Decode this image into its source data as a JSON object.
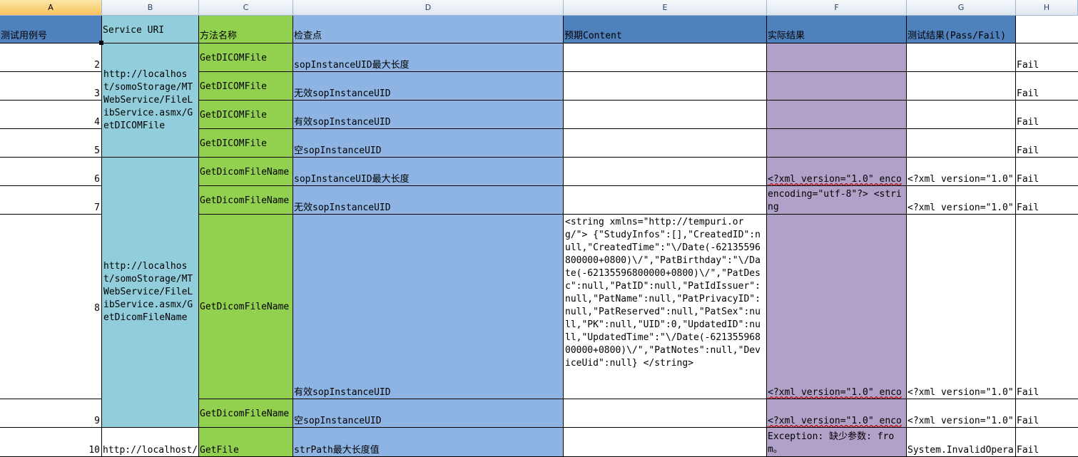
{
  "column_headers": [
    "A",
    "B",
    "C",
    "D",
    "E",
    "F",
    "G",
    "H"
  ],
  "active_column": "A",
  "table_headers": {
    "a": "测试用例号",
    "b": "Service URI",
    "c": "方法名称",
    "d": "检查点",
    "e": "预期Content",
    "f": "实际结果",
    "g": "测试结果(Pass/Fail)"
  },
  "rows": [
    {
      "num": "2",
      "method": "GetDICOMFile",
      "check": "sopInstanceUID最大长度",
      "expected": "",
      "actual": "",
      "result": "",
      "h": "Fail"
    },
    {
      "num": "3",
      "method": "GetDICOMFile",
      "check": "无效sopInstanceUID",
      "expected": "",
      "actual": "",
      "result": "",
      "h": "Fail"
    },
    {
      "num": "4",
      "method": "GetDICOMFile",
      "check": "有效sopInstanceUID",
      "expected": "",
      "actual": "",
      "result": "",
      "h": "Fail"
    },
    {
      "num": "5",
      "method": "GetDICOMFile",
      "check": "空sopInstanceUID",
      "expected": "",
      "actual": "",
      "result": "",
      "h": "Fail"
    },
    {
      "num": "6",
      "method": "GetDicomFileName",
      "check": "sopInstanceUID最大长度",
      "expected": "",
      "actual": "<?xml version=\"1.0\" enco",
      "result": "<?xml version=\"1.0\"",
      "h": "Fail"
    },
    {
      "num": "7",
      "method": "GetDicomFileName",
      "check": "无效sopInstanceUID",
      "expected": "",
      "actual": "encoding=\"utf-8\"?> <string",
      "result": "<?xml version=\"1.0\"",
      "h": "Fail"
    },
    {
      "num": "8",
      "method": "GetDicomFileName",
      "check": "有效sopInstanceUID",
      "expected": "<string xmlns=\"http://tempuri.org/\"> {\"StudyInfos\":[],\"CreatedID\":null,\"CreatedTime\":\"\\/Date(-62135596800000+0800)\\/\",\"PatBirthday\":\"\\/Date(-62135596800000+0800)\\/\",\"PatDesc\":null,\"PatID\":null,\"PatIdIssuer\":null,\"PatName\":null,\"PatPrivacyID\":null,\"PatReserved\":null,\"PatSex\":null,\"PK\":null,\"UID\":0,\"UpdatedID\":null,\"UpdatedTime\":\"\\/Date(-62135596800000+0800)\\/\",\"PatNotes\":null,\"DeviceUid\":null} </string>",
      "actual": "<?xml version=\"1.0\" enco",
      "result": "<?xml version=\"1.0\"",
      "h": "Fail"
    },
    {
      "num": "9",
      "method": "GetDicomFileName",
      "check": "空sopInstanceUID",
      "expected": "",
      "actual": "<?xml version=\"1.0\" enco",
      "result": "<?xml version=\"1.0\"",
      "h": "Fail"
    },
    {
      "num": "10",
      "method": "GetFile",
      "check": "strPath最大长度值",
      "expected": "",
      "actual": "Exception: 缺少参数: from。",
      "result": "System.InvalidOpera",
      "h": "Fail"
    }
  ],
  "service_uris": [
    "http://localhost/somoStorage/MTWebService/FileLibService.asmx/GetDICOMFile",
    "http://localhost/somoStorage/MTWebService/FileLibService.asmx/GetDicomFileName",
    "http://localhost/"
  ],
  "colors": {
    "checkpoint_blue": "#8db4e2",
    "header_dark_blue": "#4f81bd",
    "uri_turquoise": "#92cddc",
    "method_green": "#92d050",
    "actual_purple": "#b1a0c7"
  }
}
